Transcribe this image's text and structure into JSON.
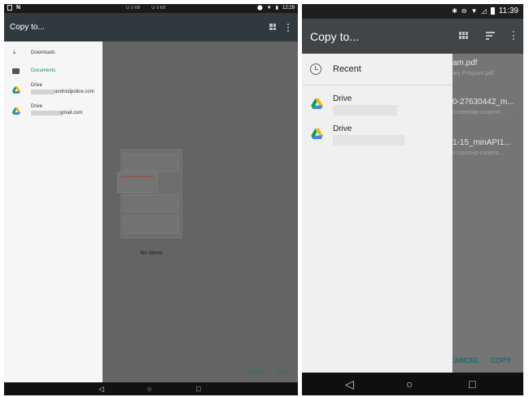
{
  "left_screen": {
    "status_bar": {
      "left_glyph": "N",
      "mid_left": "U: 0 KB",
      "mid_right": "U: 0 KB",
      "time": "12:29"
    },
    "drawer": {
      "title": "Copy to...",
      "items": [
        {
          "label": "Downloads",
          "icon": "download-icon",
          "active": false
        },
        {
          "label": "Documents",
          "icon": "folder-icon",
          "active": true
        },
        {
          "label": "Drive",
          "icon": "google-drive-icon",
          "account_suffix": "androidpolice.com"
        },
        {
          "label": "Drive",
          "icon": "google-drive-icon",
          "account_suffix": "gmail.com"
        }
      ]
    },
    "toolbar_icons": [
      "grid-view-icon",
      "overflow-menu-icon"
    ],
    "empty_state_text": "No items",
    "actions": {
      "cancel": "CANCEL",
      "copy": "COPY"
    },
    "nav": {
      "back": "◁",
      "home": "○",
      "recents": "□"
    }
  },
  "right_screen": {
    "status_bar": {
      "time": "11:39"
    },
    "drawer": {
      "title": "Copy to...",
      "recent_label": "Recent",
      "items": [
        {
          "label": "Drive",
          "icon": "google-drive-icon"
        },
        {
          "label": "Drive",
          "icon": "google-drive-icon"
        }
      ]
    },
    "toolbar_icons": [
      "grid-view-icon",
      "sort-icon",
      "overflow-menu-icon"
    ],
    "files": [
      {
        "name": "am.pdf",
        "subtitle": "ary Program.pdf"
      },
      {
        "name": "0-27630442_m...",
        "subtitle": "cr.com/wp-content/..."
      },
      {
        "name": "1-15_minAPI1...",
        "subtitle": "cr.com/wp-content..."
      }
    ],
    "actions": {
      "cancel": "CANCEL",
      "copy": "COPY"
    },
    "nav": {
      "back": "◁",
      "home": "○",
      "recents": "□"
    }
  },
  "colors": {
    "accent_teal": "#1a8a7a",
    "drive_yellow": "#f4b400",
    "drive_blue": "#4285f4",
    "drive_green": "#0f9d58"
  }
}
